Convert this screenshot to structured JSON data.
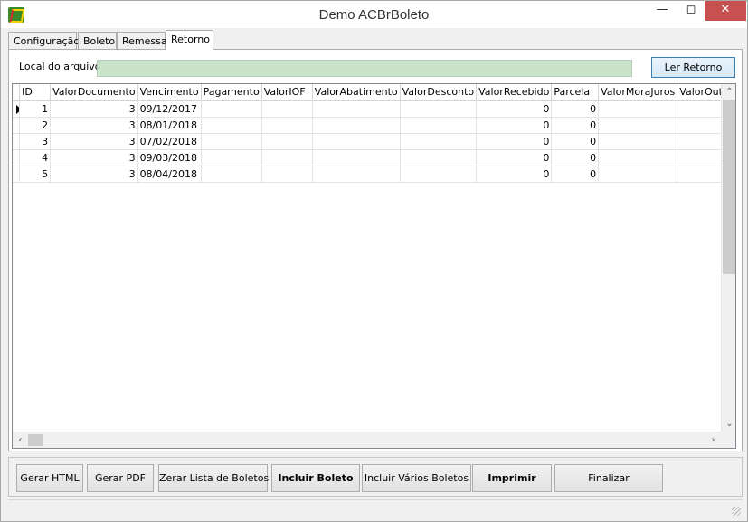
{
  "window": {
    "title": "Demo ACBrBoleto",
    "min_icon": "minimize-icon",
    "max_icon": "maximize-icon",
    "close_icon": "close-icon",
    "app_icon": "acbr-app-icon"
  },
  "tabs": [
    "Configuração",
    "Boleto",
    "Remessa",
    "Retorno"
  ],
  "active_tab": "Retorno",
  "retorno": {
    "local_label": "Local do arquivo",
    "local_value": "",
    "ler_button": "Ler Retorno"
  },
  "grid": {
    "columns": [
      "ID",
      "ValorDocumento",
      "Vencimento",
      "Pagamento",
      "ValorIOF",
      "ValorAbatimento",
      "ValorDesconto",
      "ValorRecebido",
      "Parcela",
      "ValorMoraJuros",
      "ValorOutro"
    ],
    "rows": [
      {
        "id": "1",
        "valor_documento": "3",
        "vencimento": "09/12/2017",
        "pagamento": "",
        "valor_iof": "",
        "valor_abatimento": "",
        "valor_desconto": "",
        "valor_recebido": "0",
        "parcela": "0",
        "valor_mora_juros": "",
        "valor_outro": ""
      },
      {
        "id": "2",
        "valor_documento": "3",
        "vencimento": "08/01/2018",
        "pagamento": "",
        "valor_iof": "",
        "valor_abatimento": "",
        "valor_desconto": "",
        "valor_recebido": "0",
        "parcela": "0",
        "valor_mora_juros": "",
        "valor_outro": ""
      },
      {
        "id": "3",
        "valor_documento": "3",
        "vencimento": "07/02/2018",
        "pagamento": "",
        "valor_iof": "",
        "valor_abatimento": "",
        "valor_desconto": "",
        "valor_recebido": "0",
        "parcela": "0",
        "valor_mora_juros": "",
        "valor_outro": ""
      },
      {
        "id": "4",
        "valor_documento": "3",
        "vencimento": "09/03/2018",
        "pagamento": "",
        "valor_iof": "",
        "valor_abatimento": "",
        "valor_desconto": "",
        "valor_recebido": "0",
        "parcela": "0",
        "valor_mora_juros": "",
        "valor_outro": ""
      },
      {
        "id": "5",
        "valor_documento": "3",
        "vencimento": "08/04/2018",
        "pagamento": "",
        "valor_iof": "",
        "valor_abatimento": "",
        "valor_desconto": "",
        "valor_recebido": "0",
        "parcela": "0",
        "valor_mora_juros": "",
        "valor_outro": ""
      }
    ]
  },
  "buttons": {
    "gerar_html": "Gerar HTML",
    "gerar_pdf": "Gerar PDF",
    "zerar_lista": "Zerar Lista de Boletos",
    "incluir_boleto": "Incluir Boleto",
    "incluir_varios": "Incluir Vários Boletos",
    "imprimir": "Imprimir",
    "finalizar": "Finalizar"
  },
  "colors": {
    "local_input_bg": "#c8e3ca",
    "close_button_bg": "#c75050",
    "default_button_border": "#3c7fb1"
  }
}
